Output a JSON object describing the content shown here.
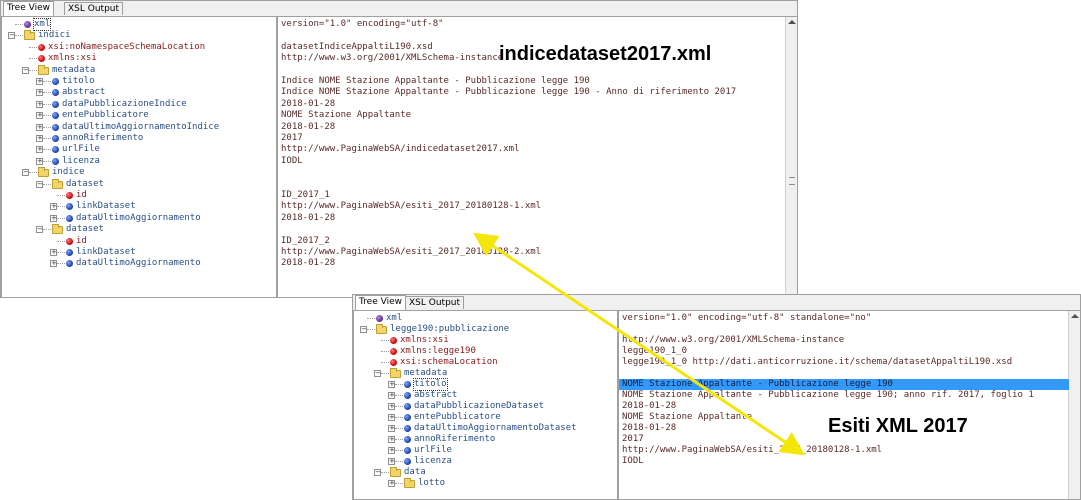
{
  "window1": {
    "tabs": [
      {
        "label": "Tree View",
        "active": true
      },
      {
        "label": "XSL Output",
        "active": false
      }
    ],
    "file_label": "indicedataset2017.xml",
    "tree": [
      {
        "indent": 0,
        "icon": "xmlp",
        "label": "xml",
        "type": "elem",
        "exp": "",
        "selected": true
      },
      {
        "indent": 0,
        "icon": "folder",
        "label": "indici",
        "type": "elem",
        "exp": "-"
      },
      {
        "indent": 1,
        "icon": "attr",
        "label": "xsi:noNamespaceSchemaLocation",
        "type": "attr",
        "exp": ""
      },
      {
        "indent": 1,
        "icon": "attr",
        "label": "xmlns:xsi",
        "type": "attr",
        "exp": ""
      },
      {
        "indent": 1,
        "icon": "folder",
        "label": "metadata",
        "type": "elem",
        "exp": "-"
      },
      {
        "indent": 2,
        "icon": "elem",
        "label": "titolo",
        "type": "elem",
        "exp": "+"
      },
      {
        "indent": 2,
        "icon": "elem",
        "label": "abstract",
        "type": "elem",
        "exp": "+"
      },
      {
        "indent": 2,
        "icon": "elem",
        "label": "dataPubblicazioneIndice",
        "type": "elem",
        "exp": "+"
      },
      {
        "indent": 2,
        "icon": "elem",
        "label": "entePubblicatore",
        "type": "elem",
        "exp": "+"
      },
      {
        "indent": 2,
        "icon": "elem",
        "label": "dataUltimoAggiornamentoIndice",
        "type": "elem",
        "exp": "+"
      },
      {
        "indent": 2,
        "icon": "elem",
        "label": "annoRiferimento",
        "type": "elem",
        "exp": "+"
      },
      {
        "indent": 2,
        "icon": "elem",
        "label": "urlFile",
        "type": "elem",
        "exp": "+"
      },
      {
        "indent": 2,
        "icon": "elem",
        "label": "licenza",
        "type": "elem",
        "exp": "+"
      },
      {
        "indent": 1,
        "icon": "folder",
        "label": "indice",
        "type": "elem",
        "exp": "-"
      },
      {
        "indent": 2,
        "icon": "folder",
        "label": "dataset",
        "type": "elem",
        "exp": "-"
      },
      {
        "indent": 3,
        "icon": "attr",
        "label": "id",
        "type": "attr",
        "exp": ""
      },
      {
        "indent": 3,
        "icon": "elem",
        "label": "linkDataset",
        "type": "elem",
        "exp": "+"
      },
      {
        "indent": 3,
        "icon": "elem",
        "label": "dataUltimoAggiornamento",
        "type": "elem",
        "exp": "+"
      },
      {
        "indent": 2,
        "icon": "folder",
        "label": "dataset",
        "type": "elem",
        "exp": "-"
      },
      {
        "indent": 3,
        "icon": "attr",
        "label": "id",
        "type": "attr",
        "exp": ""
      },
      {
        "indent": 3,
        "icon": "elem",
        "label": "linkDataset",
        "type": "elem",
        "exp": "+"
      },
      {
        "indent": 3,
        "icon": "elem",
        "label": "dataUltimoAggiornamento",
        "type": "elem",
        "exp": "+"
      }
    ],
    "values": [
      "version=\"1.0\" encoding=\"utf-8\"",
      "",
      "datasetIndiceAppaltiL190.xsd",
      "http://www.w3.org/2001/XMLSchema-instance",
      "",
      "Indice NOME Stazione Appaltante - Pubblicazione legge 190",
      "Indice NOME Stazione Appaltante - Pubblicazione legge 190 - Anno di riferimento 2017",
      "2018-01-28",
      "NOME Stazione Appaltante",
      "2018-01-28",
      "2017",
      "http://www.PaginaWebSA/indicedataset2017.xml",
      "IODL",
      "",
      "",
      "ID_2017_1",
      "http://www.PaginaWebSA/esiti_2017_20180128-1.xml",
      "2018-01-28",
      "",
      "ID_2017_2",
      "http://www.PaginaWebSA/esiti_2017_20180128-2.xml",
      "2018-01-28"
    ]
  },
  "window2": {
    "tabs": [
      {
        "label": "Tree View",
        "active": true
      },
      {
        "label": "XSL Output",
        "active": false
      }
    ],
    "file_label": "Esiti XML 2017",
    "tree": [
      {
        "indent": 0,
        "icon": "xmlp",
        "label": "xml",
        "type": "elem",
        "exp": ""
      },
      {
        "indent": 0,
        "icon": "folder",
        "label": "legge190:pubblicazione",
        "type": "elem",
        "exp": "-"
      },
      {
        "indent": 1,
        "icon": "attr",
        "label": "xmlns:xsi",
        "type": "attr",
        "exp": ""
      },
      {
        "indent": 1,
        "icon": "attr",
        "label": "xmlns:legge190",
        "type": "attr",
        "exp": ""
      },
      {
        "indent": 1,
        "icon": "attr",
        "label": "xsi:schemaLocation",
        "type": "attr",
        "exp": ""
      },
      {
        "indent": 1,
        "icon": "folder",
        "label": "metadata",
        "type": "elem",
        "exp": "-"
      },
      {
        "indent": 2,
        "icon": "elem",
        "label": "titolo",
        "type": "elem",
        "exp": "+",
        "selected": true
      },
      {
        "indent": 2,
        "icon": "elem",
        "label": "abstract",
        "type": "elem",
        "exp": "+"
      },
      {
        "indent": 2,
        "icon": "elem",
        "label": "dataPubblicazioneDataset",
        "type": "elem",
        "exp": "+"
      },
      {
        "indent": 2,
        "icon": "elem",
        "label": "entePubblicatore",
        "type": "elem",
        "exp": "+"
      },
      {
        "indent": 2,
        "icon": "elem",
        "label": "dataUltimoAggiornamentoDataset",
        "type": "elem",
        "exp": "+"
      },
      {
        "indent": 2,
        "icon": "elem",
        "label": "annoRiferimento",
        "type": "elem",
        "exp": "+"
      },
      {
        "indent": 2,
        "icon": "elem",
        "label": "urlFile",
        "type": "elem",
        "exp": "+"
      },
      {
        "indent": 2,
        "icon": "elem",
        "label": "licenza",
        "type": "elem",
        "exp": "+"
      },
      {
        "indent": 1,
        "icon": "folder",
        "label": "data",
        "type": "elem",
        "exp": "-"
      },
      {
        "indent": 2,
        "icon": "folder",
        "label": "lotto",
        "type": "elem",
        "exp": "+"
      }
    ],
    "values": [
      "version=\"1.0\" encoding=\"utf-8\" standalone=\"no\"",
      "",
      "http://www.w3.org/2001/XMLSchema-instance",
      "legge190_1_0",
      "legge190_1_0 http://dati.anticorruzione.it/schema/datasetAppaltiL190.xsd",
      "",
      "NOME Stazione Appaltante - Pubblicazione legge 190",
      "NOME Stazione Appaltante - Pubblicazione legge 190; anno rif. 2017, foglio 1",
      "2018-01-28",
      "NOME Stazione Appaltante",
      "2018-01-28",
      "2017",
      "http://www.PaginaWebSA/esiti_2017_20180128-1.xml",
      "IODL",
      "",
      ""
    ],
    "highlight_index": 6
  },
  "arrow_color": "#f5e60a",
  "tree_text_color": "#2a4f8a",
  "attr_text_color": "#8a1a1a",
  "highlight_color": "#3399ff"
}
